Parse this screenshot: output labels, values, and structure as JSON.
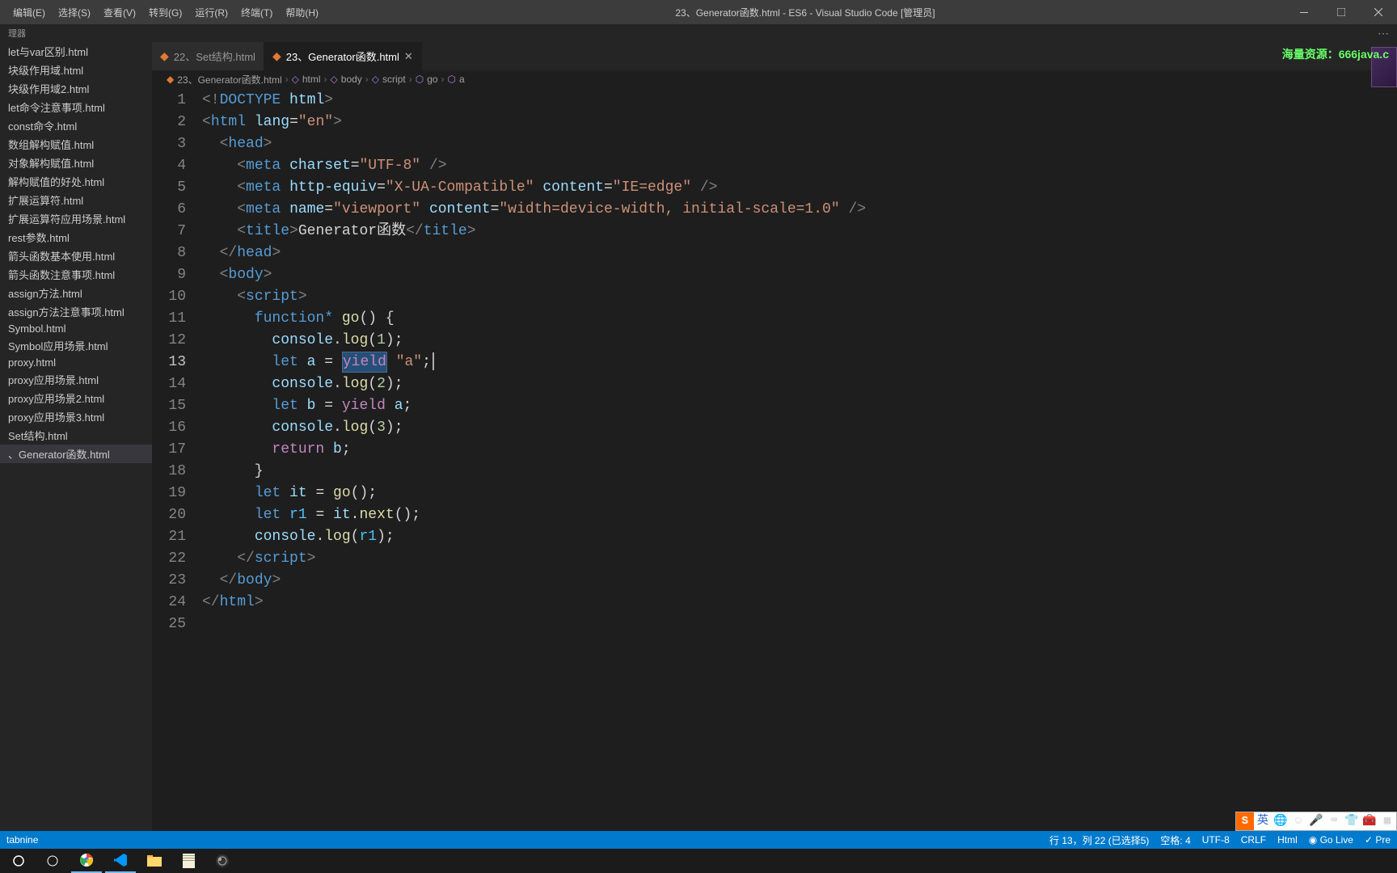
{
  "window": {
    "title": "23、Generator函数.html - ES6 - Visual Studio Code [管理员]",
    "menu": [
      "编辑(E)",
      "选择(S)",
      "查看(V)",
      "转到(G)",
      "运行(R)",
      "终端(T)",
      "帮助(H)"
    ]
  },
  "topbar": {
    "left": "理器",
    "gear": "⚙"
  },
  "sidebar": {
    "files": [
      "let与var区别.html",
      "块级作用域.html",
      "块级作用域2.html",
      "let命令注意事项.html",
      "const命令.html",
      "数组解构赋值.html",
      "对象解构赋值.html",
      "解构赋值的好处.html",
      "扩展运算符.html",
      "扩展运算符应用场景.html",
      "rest参数.html",
      "箭头函数基本使用.html",
      "箭头函数注意事项.html",
      "assign方法.html",
      "assign方法注意事项.html",
      "Symbol.html",
      "Symbol应用场景.html",
      "proxy.html",
      "proxy应用场景.html",
      "proxy应用场景2.html",
      "proxy应用场景3.html",
      "Set结构.html",
      "、Generator函数.html"
    ],
    "active_index": 22
  },
  "tabs": [
    {
      "label": "22、Set结构.html",
      "active": false,
      "close": false
    },
    {
      "label": "23、Generator函数.html",
      "active": true,
      "close": true
    }
  ],
  "promo": "海量资源：666java.c",
  "breadcrumb": [
    "23、Generator函数.html",
    "html",
    "body",
    "script",
    "go",
    "a"
  ],
  "code": {
    "active_line": 13,
    "lines": 25
  },
  "ime": {
    "s": "S",
    "lang": "英"
  },
  "statusbar": {
    "left": [
      "tabnine"
    ],
    "right": [
      "行 13，列 22 (已选择5)",
      "空格: 4",
      "UTF-8",
      "CRLF",
      "Html",
      "◉ Go Live",
      "✓ Pre"
    ]
  },
  "taskbar": {
    "icons": [
      "⊞",
      "○",
      "◧",
      "◆",
      "▭",
      "▤",
      "●"
    ]
  }
}
